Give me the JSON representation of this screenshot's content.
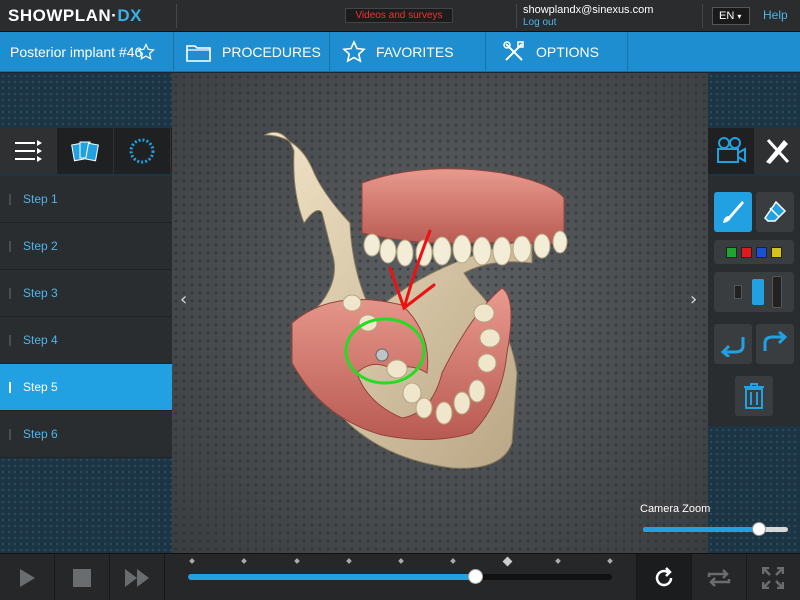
{
  "topbar": {
    "logo_text": "SHOWPLAN·",
    "logo_dx": "DX",
    "videos_label": "Videos and surveys",
    "user_email": "showplandx@sinexus.com",
    "logout_label": "Log out",
    "language": "EN",
    "help_label": "Help"
  },
  "navbar": {
    "case_title": "Posterior implant #46",
    "procedures_label": "PROCEDURES",
    "favorites_label": "FAVORITES",
    "options_label": "OPTIONS"
  },
  "steps": [
    {
      "label": "Step 1",
      "active": false
    },
    {
      "label": "Step 2",
      "active": false
    },
    {
      "label": "Step 3",
      "active": false
    },
    {
      "label": "Step 4",
      "active": false
    },
    {
      "label": "Step 5",
      "active": true
    },
    {
      "label": "Step 6",
      "active": false
    }
  ],
  "drawing_colors": [
    "#1fa52f",
    "#e01b1b",
    "#1a4fd6",
    "#d6c21a"
  ],
  "annotation_colors": {
    "arrow": "#ee1111",
    "circle": "#22dd22"
  },
  "accent_color": "#22a1e2",
  "camera_zoom": {
    "label": "Camera Zoom",
    "value": 0.8
  },
  "timeline": {
    "progress": 0.68,
    "tick_count": 9,
    "current_tick": 6
  },
  "icons": [
    "star-icon",
    "folder-icon",
    "star-icon",
    "tools-icon",
    "steps-list-icon",
    "teeth-cards-icon",
    "spinner-icon",
    "camera-icon",
    "draw-tools-icon",
    "brush-icon",
    "eraser-icon",
    "undo-icon",
    "redo-icon",
    "trash-icon",
    "play-icon",
    "stop-icon",
    "fast-forward-icon",
    "refresh-icon",
    "loop-icon",
    "fullscreen-icon"
  ]
}
